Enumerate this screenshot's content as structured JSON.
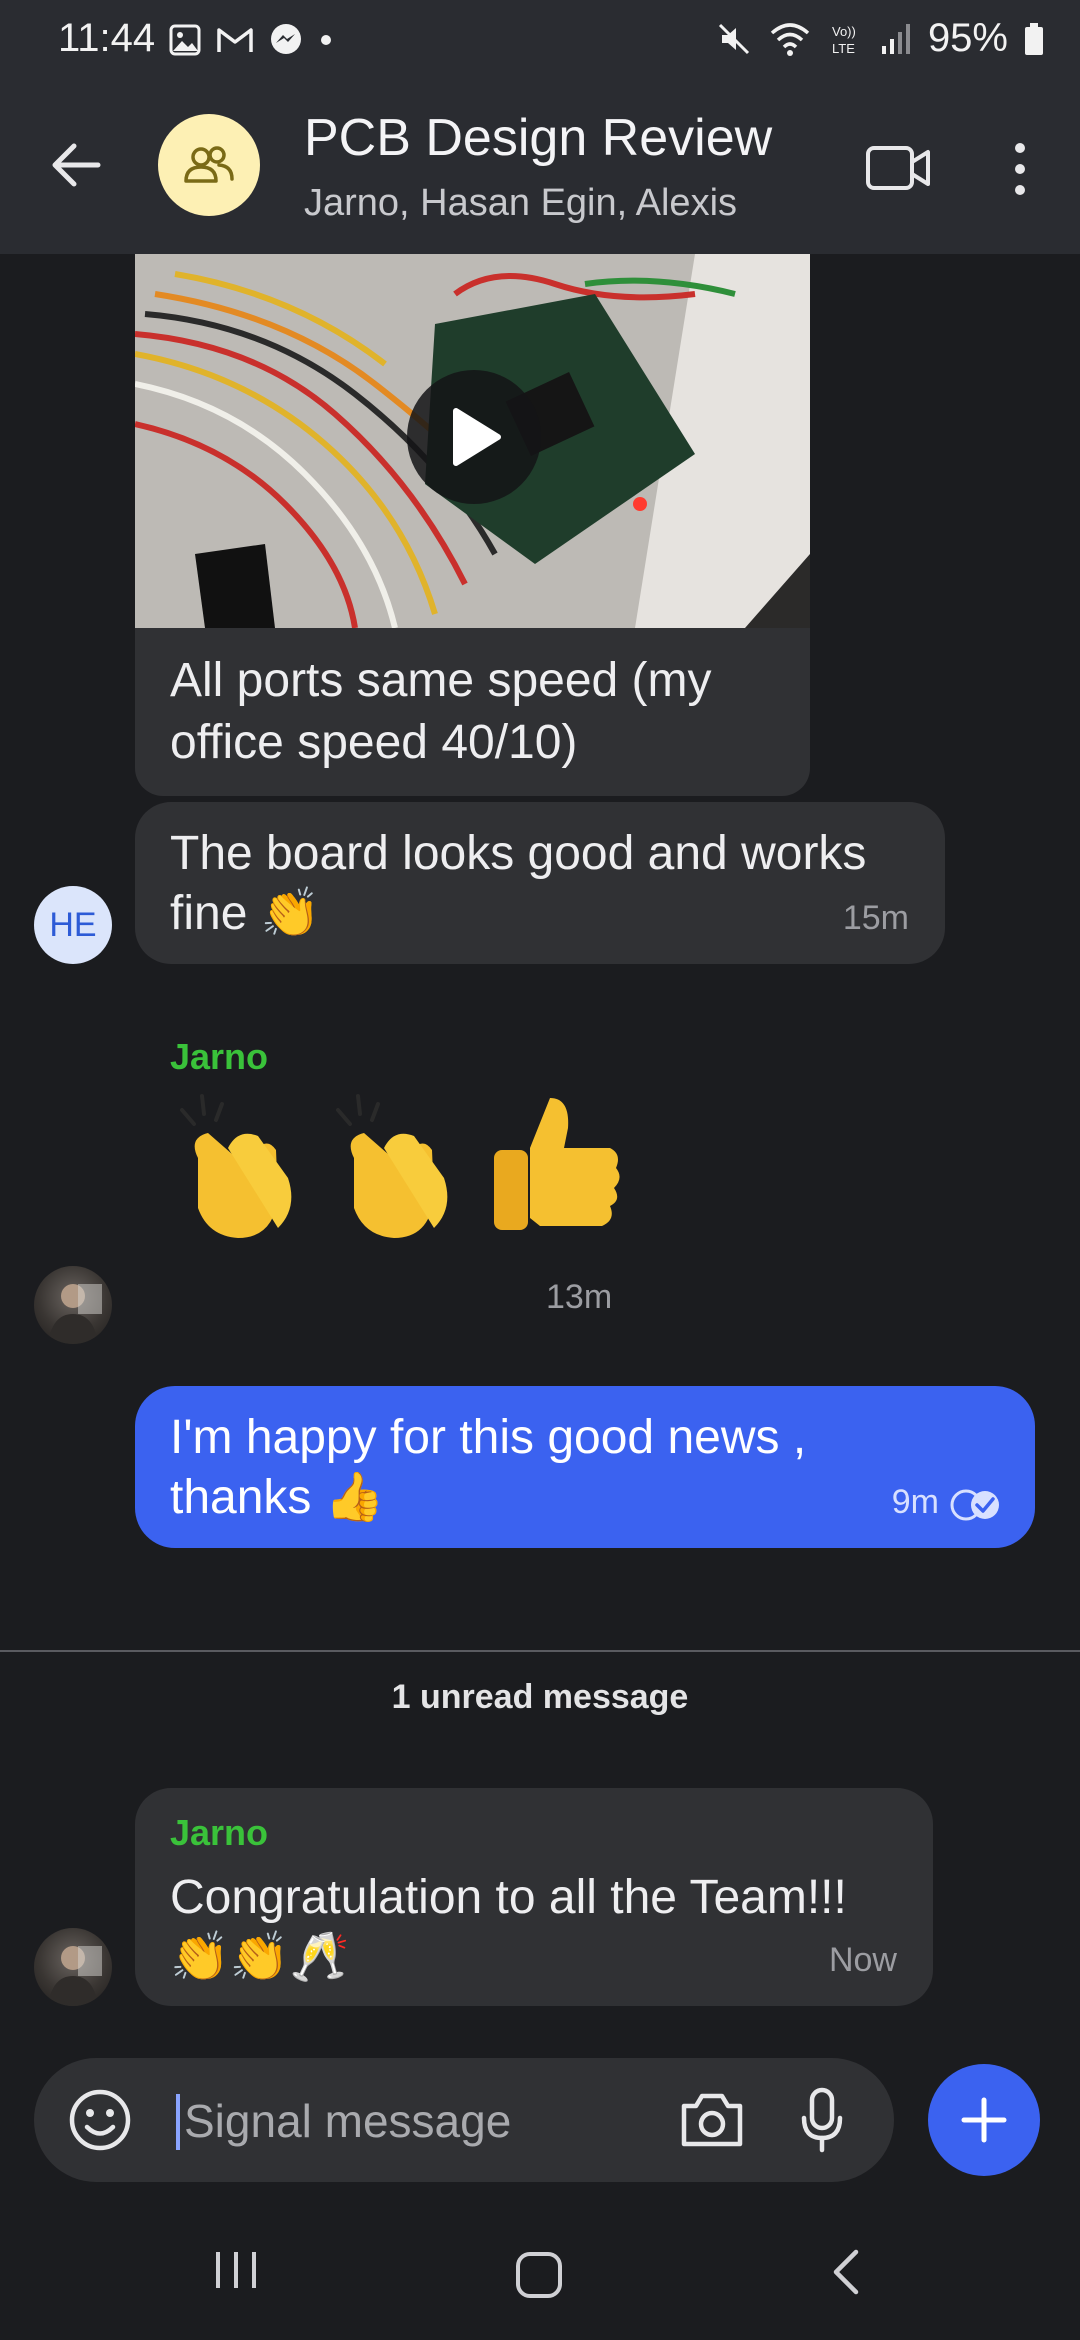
{
  "status_bar": {
    "time": "11:44",
    "battery": "95%",
    "icons": [
      "gallery-icon",
      "gmail-icon",
      "messenger-icon",
      "dot-icon",
      "mute-icon",
      "wifi-icon",
      "volte-icon",
      "signal-icon",
      "battery-icon"
    ]
  },
  "header": {
    "title": "PCB Design Review",
    "members": "Jarno, Hasan Egin, Alexis",
    "avatar_color": "#fdf0b4"
  },
  "messages": {
    "media_caption": "All ports same speed (my office speed 40/10)",
    "he_message": {
      "avatar_initials": "HE",
      "text": "The board looks good and works fine 👏",
      "time": "15m"
    },
    "jarno_reaction": {
      "sender": "Jarno",
      "emojis": "👏👏👍",
      "time": "13m"
    },
    "outgoing": {
      "text": "I'm happy for this good news  , thanks  👍",
      "time": "9m"
    },
    "unread_label": "1 unread message",
    "jarno_latest": {
      "sender": "Jarno",
      "text": "Congratulation to all the Team!!! 👏👏🥂",
      "time": "Now"
    }
  },
  "composer": {
    "placeholder": "Signal message"
  },
  "colors": {
    "accent": "#3b62f0",
    "sender_name": "#3ac23a",
    "bubble": "#303134",
    "background": "#1b1c1f",
    "header": "#2a2c31"
  }
}
